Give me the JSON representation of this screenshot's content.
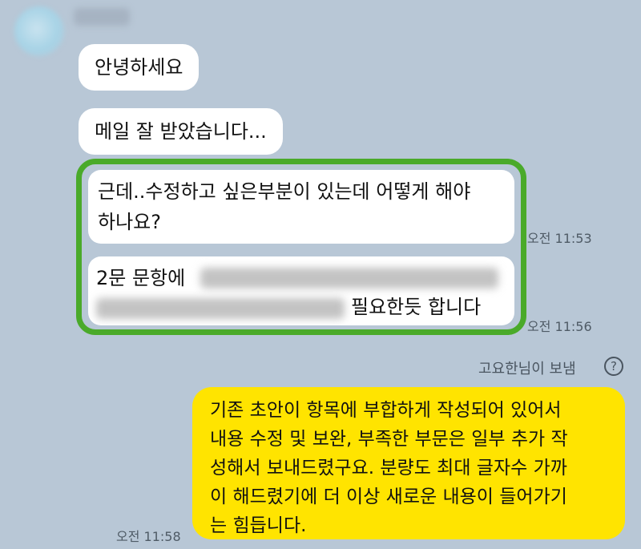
{
  "messages": {
    "m1": "안녕하세요",
    "m2": "메일 잘 받았습니다...",
    "m3_line1": "근데..수정하고 싶은부분이 있는데 어떻게 해야",
    "m3_line2": "하나요?",
    "m4_line1": "2문 문항에",
    "m4_line2": "필요한듯 합니다",
    "time1": "오전 11:53",
    "time2": "오전 11:56"
  },
  "reply": {
    "read_label": "고요한님이 보냄",
    "help_glyph": "?",
    "lines": [
      "기존 초안이 항목에 부합하게 작성되어 있어서",
      "내용 수정 및 보완, 부족한 부문은 일부 추가 작",
      "성해서 보내드렸구요. 분량도 최대 글자수 가까",
      "이 해드렸기에 더 이상 새로운 내용이 들어가기",
      "는 힘듭니다."
    ],
    "time": "오전 11:58"
  },
  "colors": {
    "background": "#b8c7d6",
    "received_bubble": "#ffffff",
    "sent_bubble": "#ffe400",
    "highlight_border": "#4aaa2a"
  }
}
